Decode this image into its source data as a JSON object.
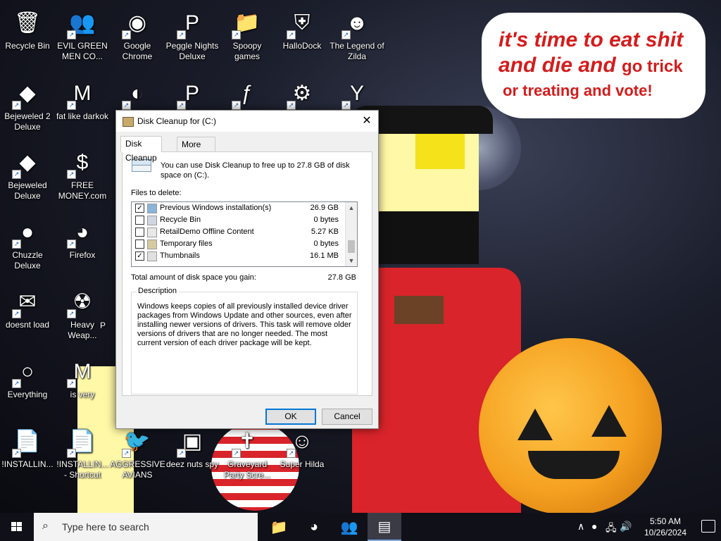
{
  "desktop": {
    "icons": [
      {
        "label": "Recycle Bin",
        "icon": "recycle-bin-icon",
        "glyph": "🗑"
      },
      {
        "label": "EVIL GREEN MEN CO...",
        "icon": "green-men-icon",
        "glyph": "👥"
      },
      {
        "label": "Google Chrome",
        "icon": "chrome-icon",
        "glyph": "◉"
      },
      {
        "label": "Peggle Nights Deluxe",
        "icon": "peggle-icon",
        "glyph": "P"
      },
      {
        "label": "Spoopy games",
        "icon": "folder-icon",
        "glyph": "📁"
      },
      {
        "label": "HalloDock",
        "icon": "windows-shield-icon",
        "glyph": "⛨"
      },
      {
        "label": "The Legend of Zilda",
        "icon": "zilda-icon",
        "glyph": "☻"
      },
      {
        "label": "Bejeweled 2 Deluxe",
        "icon": "bejeweled2-icon",
        "glyph": "◆"
      },
      {
        "label": "fat like darkok",
        "icon": "mpl-icon",
        "glyph": "M"
      },
      {
        "label": "",
        "icon": "edge-icon",
        "glyph": "◐"
      },
      {
        "label": "",
        "icon": "peggle-deluxe-icon",
        "glyph": "P"
      },
      {
        "label": "",
        "icon": "flash-icon",
        "glyph": "ƒ"
      },
      {
        "label": "",
        "icon": "settings-shortcut-icon",
        "glyph": "⚙"
      },
      {
        "label": "",
        "icon": "yashma-icon",
        "glyph": "Y"
      },
      {
        "label": "Bejeweled Deluxe",
        "icon": "bejeweled-icon",
        "glyph": "◆"
      },
      {
        "label": "FREE MONEY.com",
        "icon": "money-bag-icon",
        "glyph": "$"
      },
      {
        "label": "Chuzzle Deluxe",
        "icon": "chuzzle-icon",
        "glyph": "●"
      },
      {
        "label": "Firefox",
        "icon": "firefox-icon",
        "glyph": "◕"
      },
      {
        "label": "doesnt load",
        "icon": "thunderbird-icon",
        "glyph": "✉"
      },
      {
        "label": "Heavy Weap...",
        "icon": "radiation-icon",
        "glyph": "☢"
      },
      {
        "label": "Everything",
        "icon": "search-everything-icon",
        "glyph": "○"
      },
      {
        "label": "is very",
        "icon": "shield-mp-icon",
        "glyph": "M"
      },
      {
        "label": "!INSTALLIN...",
        "icon": "document-icon",
        "glyph": "📄"
      },
      {
        "label": "!INSTALLIN... - Shortcut",
        "icon": "document-shortcut-icon",
        "glyph": "📄"
      },
      {
        "label": "AGGRESSIVE AVIANS",
        "icon": "angry-bird-icon",
        "glyph": "🐦"
      },
      {
        "label": "deez nuts spy",
        "icon": "windows-stack-icon",
        "glyph": "▣"
      },
      {
        "label": "Graveyard Party Scre...",
        "icon": "graveyard-icon",
        "glyph": "✝"
      },
      {
        "label": "Super Hilda",
        "icon": "hilda-icon",
        "glyph": "☺"
      }
    ],
    "partial_label": "P",
    "bubble": {
      "line1": "it's time to eat shit",
      "line2_a": "and die and",
      "line2_b": "go trick",
      "line3": "or treating and vote!"
    },
    "colors": {
      "bubble_text": "#d41c1c",
      "pumpkin": "#f5a020"
    }
  },
  "dialog": {
    "title": "Disk Cleanup for  (C:)",
    "close": "✕",
    "tabs": [
      {
        "label": "Disk Cleanup",
        "active": true
      },
      {
        "label": "More Options",
        "active": false
      }
    ],
    "intro": "You can use Disk Cleanup to free up to 27.8 GB of disk space on  (C:).",
    "files_label": "Files to delete:",
    "files": [
      {
        "checked": true,
        "name": "Previous Windows installation(s)",
        "size": "26.9 GB"
      },
      {
        "checked": false,
        "name": "Recycle Bin",
        "size": "0 bytes"
      },
      {
        "checked": false,
        "name": "RetailDemo Offline Content",
        "size": "5.27 KB"
      },
      {
        "checked": false,
        "name": "Temporary files",
        "size": "0 bytes"
      },
      {
        "checked": true,
        "name": "Thumbnails",
        "size": "16.1 MB"
      }
    ],
    "total_label": "Total amount of disk space you gain:",
    "total_value": "27.8 GB",
    "description_label": "Description",
    "description": "Windows keeps copies of all previously installed device driver packages from Windows Update and other sources, even after installing newer versions of drivers. This task will remove older versions of drivers that are no longer needed. The most current version of each driver package will be kept.",
    "ok": "OK",
    "cancel": "Cancel",
    "check_mark": "✓"
  },
  "taskbar": {
    "search_placeholder": "Type here to search",
    "search_glyph": "⌕",
    "apps": [
      {
        "icon": "file-explorer-icon",
        "glyph": "📁",
        "active": false
      },
      {
        "icon": "firefox-taskbar-icon",
        "glyph": "◕",
        "active": false
      },
      {
        "icon": "green-men-taskbar-icon",
        "glyph": "👥",
        "active": false
      },
      {
        "icon": "disk-cleanup-taskbar-icon",
        "glyph": "▤",
        "active": true
      }
    ],
    "tray": {
      "chevron": "∧",
      "network": "🖧",
      "volume": "🔊"
    },
    "time": "5:50 AM",
    "date": "10/26/2024"
  }
}
